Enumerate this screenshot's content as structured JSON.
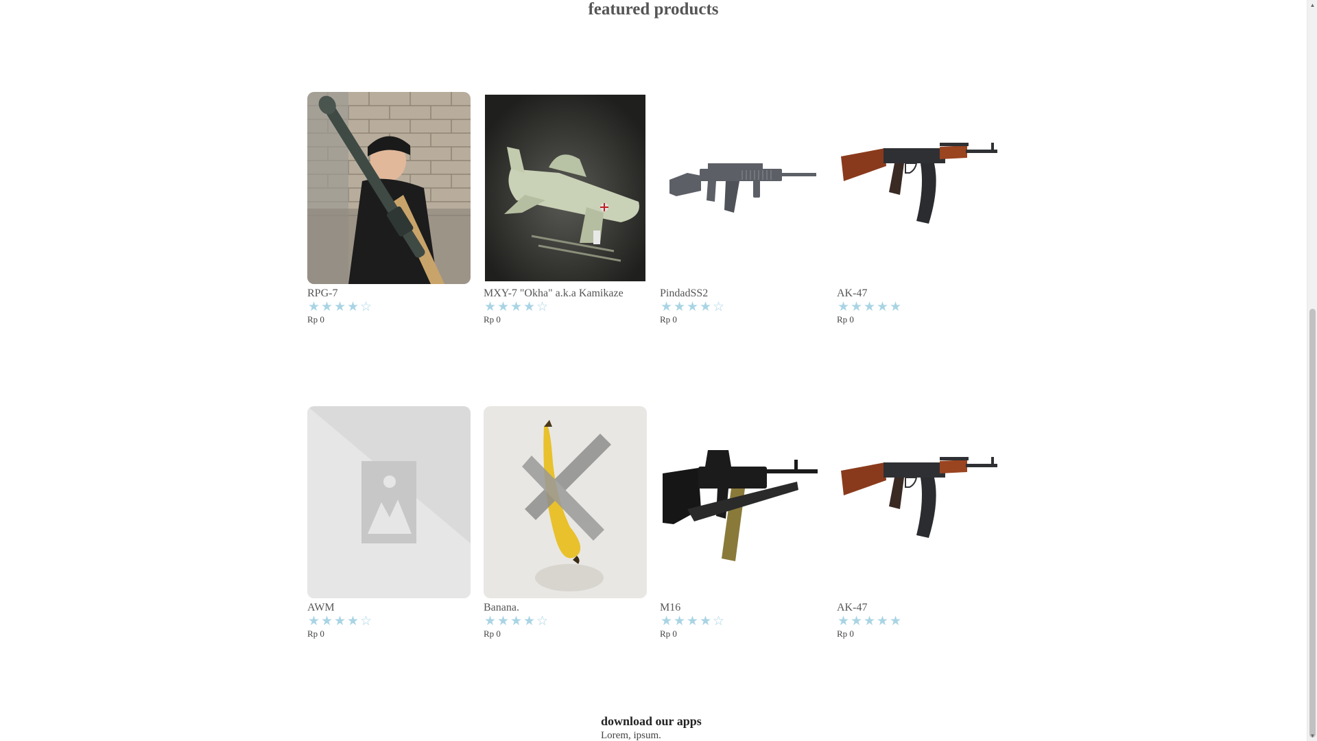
{
  "section": {
    "title": "featured products"
  },
  "products": [
    {
      "name": "RPG-7",
      "rating": 4,
      "price": "Rp 0",
      "image_icon": "rpg-launcher-photo"
    },
    {
      "name": "MXY-7 \"Okha\" a.k.a Kamikaze",
      "rating": 4,
      "price": "Rp 0",
      "image_icon": "okha-rocket-plane-photo"
    },
    {
      "name": "PindadSS2",
      "rating": 4,
      "price": "Rp 0",
      "image_icon": "assault-rifle-photo"
    },
    {
      "name": "AK-47",
      "rating": 5,
      "price": "Rp 0",
      "image_icon": "ak47-rifle-photo"
    },
    {
      "name": "AWM",
      "rating": 4,
      "price": "Rp 0",
      "image_icon": "image-placeholder-icon"
    },
    {
      "name": "Banana.",
      "rating": 4,
      "price": "Rp 0",
      "image_icon": "taped-banana-photo"
    },
    {
      "name": "M16",
      "rating": 4,
      "price": "Rp 0",
      "image_icon": "m16-rifle-photo"
    },
    {
      "name": "AK-47",
      "rating": 5,
      "price": "Rp 0",
      "image_icon": "ak47-rifle-photo"
    }
  ],
  "rating_max": 5,
  "footer": {
    "title": "download our apps",
    "subtitle": "Lorem, ipsum."
  },
  "colors": {
    "star": "#a9d4e4",
    "heading": "#555555"
  }
}
